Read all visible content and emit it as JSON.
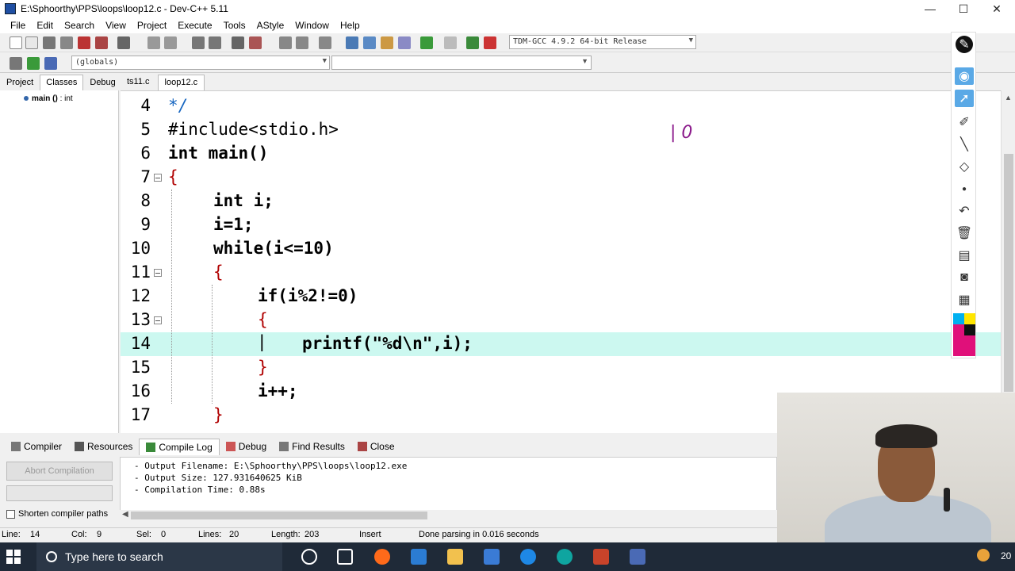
{
  "window": {
    "title": "E:\\Sphoorthy\\PPS\\loops\\loop12.c - Dev-C++ 5.11",
    "minimize": "—",
    "maximize": "☐",
    "close": "✕"
  },
  "menu": [
    "File",
    "Edit",
    "Search",
    "View",
    "Project",
    "Execute",
    "Tools",
    "AStyle",
    "Window",
    "Help"
  ],
  "toolbar": {
    "compiler": "TDM-GCC 4.9.2 64-bit Release",
    "globals": "(globals)"
  },
  "left_panel": {
    "tabs": [
      "Project",
      "Classes",
      "Debug"
    ],
    "active_tab": "Classes",
    "tree_item_name": "main ()",
    "tree_item_type": ": int"
  },
  "editor": {
    "tabs": [
      "ts11.c",
      "loop12.c"
    ],
    "active_tab": "loop12.c",
    "lines": [
      {
        "n": "4",
        "text": "*/"
      },
      {
        "n": "5",
        "text": "#include<stdio.h>"
      },
      {
        "n": "6",
        "text": "int main()"
      },
      {
        "n": "7",
        "text": "{"
      },
      {
        "n": "8",
        "text": "int i;"
      },
      {
        "n": "9",
        "text": "i=1;"
      },
      {
        "n": "10",
        "text": "while(i<=10)"
      },
      {
        "n": "11",
        "text": "{"
      },
      {
        "n": "12",
        "text": "if(i%2!=0)"
      },
      {
        "n": "13",
        "text": "{"
      },
      {
        "n": "14",
        "text": "printf(\"%d\\n\",i);"
      },
      {
        "n": "15",
        "text": "}"
      },
      {
        "n": "16",
        "text": "i++;"
      },
      {
        "n": "17",
        "text": "}"
      }
    ],
    "scribble": "| 0"
  },
  "bottom": {
    "tabs": [
      "Compiler",
      "Resources",
      "Compile Log",
      "Debug",
      "Find Results",
      "Close"
    ],
    "active_tab": "Compile Log",
    "abort_button": "Abort Compilation",
    "shorten_label": "Shorten compiler paths",
    "log": [
      "- Output Filename: E:\\Sphoorthy\\PPS\\loops\\loop12.exe",
      "- Output Size: 127.931640625 KiB",
      "- Compilation Time: 0.88s"
    ]
  },
  "status": {
    "line": "Line:",
    "line_val": "14",
    "col": "Col:",
    "col_val": "9",
    "sel": "Sel:",
    "sel_val": "0",
    "lines": "Lines:",
    "lines_val": "20",
    "length": "Length:",
    "length_val": "203",
    "mode": "Insert",
    "message": "Done parsing in 0.016 seconds"
  },
  "taskbar": {
    "search_placeholder": "Type here to search",
    "clock": "20"
  },
  "colors": {
    "highlight_line": "#ccf8f0",
    "taskbar": "#1f2a38",
    "annotation_selected": "#5aa9e6"
  }
}
